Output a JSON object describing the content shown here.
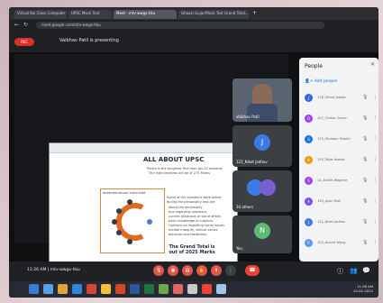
{
  "browser": {
    "tabs": [
      "Virtual Kei Class Computer Science...",
      "UPSC Mock Test",
      "Meet - mtv-wwgx-hku",
      "Ghazal Gujar/Mock Test Grand Total..."
    ],
    "url": "meet.google.com/mtv-wwgx-hku"
  },
  "meet": {
    "rec_label": "REC",
    "presenting": "Vaibhav Patil is presenting",
    "meeting_time": "11:26 AM",
    "meeting_code": "mtv-wwgx-hku"
  },
  "slide": {
    "title": "ALL ABOUT UPSC",
    "lines": [
      "Prelim is the toughest Test from Jan-22 onwards",
      "The Interview/test will be of 275 Marks",
      "Some of the questions were asked",
      "during the personality test are",
      "about the personality",
      "tips regarding questions",
      "current situations of world affairs",
      "basic knowledge of subjects",
      "Opinions on regarding social issues",
      "mental integrity, ethical values",
      "behavior and leadership"
    ],
    "diagram_label": "INTERVIEW BOARD STRUCTURE",
    "grand_total": "The Grand Total is out of 2025 Marks"
  },
  "tiles": [
    {
      "label": "Vaibhav Patil",
      "avatar": ""
    },
    {
      "label": "122_Niket Jadhav",
      "avatar": "J",
      "color": "#3c7be6"
    },
    {
      "label": "34 others",
      "avatar": "",
      "color": "#3c7be6"
    },
    {
      "label": "You",
      "avatar": "N",
      "color": "#5bb974"
    }
  ],
  "people_panel": {
    "title": "People",
    "add_people": "Add people",
    "participants": [
      {
        "name": "118_Shivaj Jadeja",
        "initial": "J",
        "color": "#3367d6"
      },
      {
        "name": "107_Omkar Gurav",
        "initial": "O",
        "color": "#a142f4"
      },
      {
        "name": "119_Shubam Shaikh",
        "initial": "S",
        "color": "#1a73e8"
      },
      {
        "name": "119_Tejas Avekar",
        "initial": "A",
        "color": "#f29900"
      },
      {
        "name": "12_Ashifa Waghire",
        "initial": "S",
        "color": "#a142f4"
      },
      {
        "name": "133_Ayan Mali",
        "initial": "A",
        "color": "#7c4dff"
      },
      {
        "name": "122_Niket Jadhav",
        "initial": "J",
        "color": "#3c7be6"
      },
      {
        "name": "103_Anand Wang",
        "initial": "P",
        "color": "#5e97f6"
      }
    ]
  },
  "taskbar": {
    "clock_time": "11:26 AM",
    "clock_date": "10-02-2022"
  }
}
